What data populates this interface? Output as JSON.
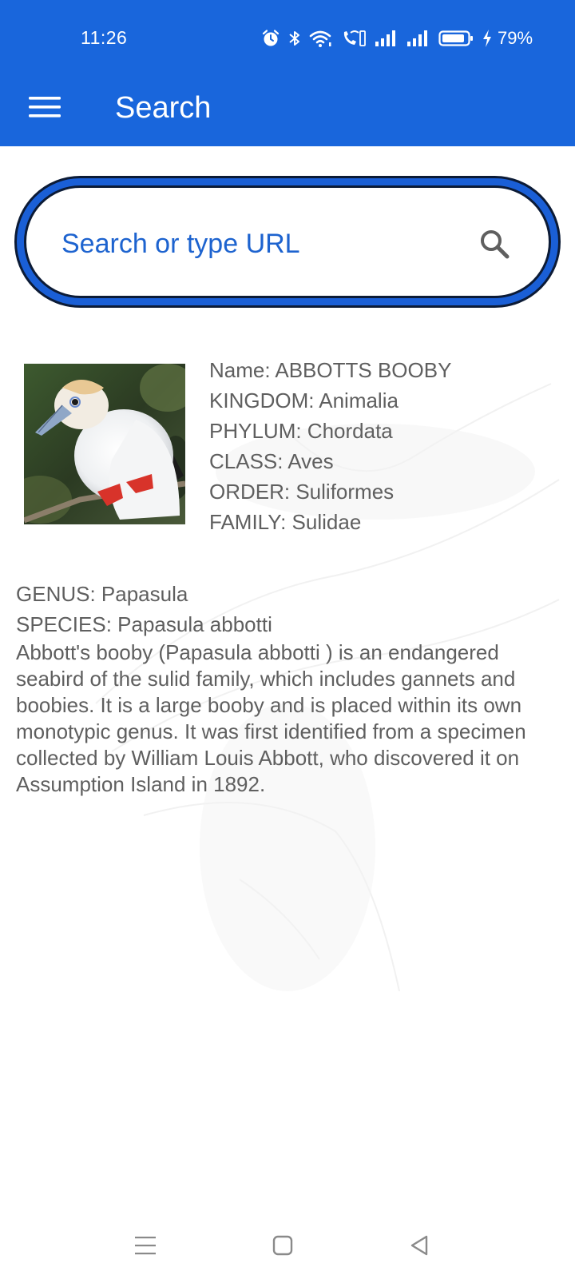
{
  "status_bar": {
    "time": "11:26",
    "battery_percent": "79%"
  },
  "app_bar": {
    "title": "Search"
  },
  "search": {
    "placeholder": "Search or type URL",
    "value": ""
  },
  "species": {
    "name": "Name: ABBOTTS BOOBY",
    "kingdom": "KINGDOM: Animalia",
    "phylum": "PHYLUM: Chordata",
    "class": "CLASS: Aves",
    "order": "ORDER: Suliformes",
    "family": "FAMILY: Sulidae",
    "genus": "GENUS: Papasula",
    "species": "SPECIES: Papasula abbotti",
    "description": "Abbott's booby (Papasula abbotti ) is an endangered seabird of the sulid family, which includes gannets and boobies. It is a large booby and is placed within its own monotypic genus. It was first identified from a specimen collected by William Louis Abbott, who discovered it on Assumption Island in 1892."
  },
  "colors": {
    "app_bar": "#1966dc",
    "search_ring": "#1a5fd6",
    "search_text": "#1d63cf",
    "body_text": "#5f5f5f"
  },
  "icons": {
    "status": [
      "alarm-icon",
      "bluetooth-icon",
      "wifi-icon",
      "wifi-calling-icon",
      "signal-icon",
      "signal-icon",
      "battery-icon",
      "charging-icon"
    ],
    "app_bar": "menu-icon",
    "search": "search-icon",
    "nav": [
      "recents-icon",
      "home-icon",
      "back-icon"
    ]
  }
}
